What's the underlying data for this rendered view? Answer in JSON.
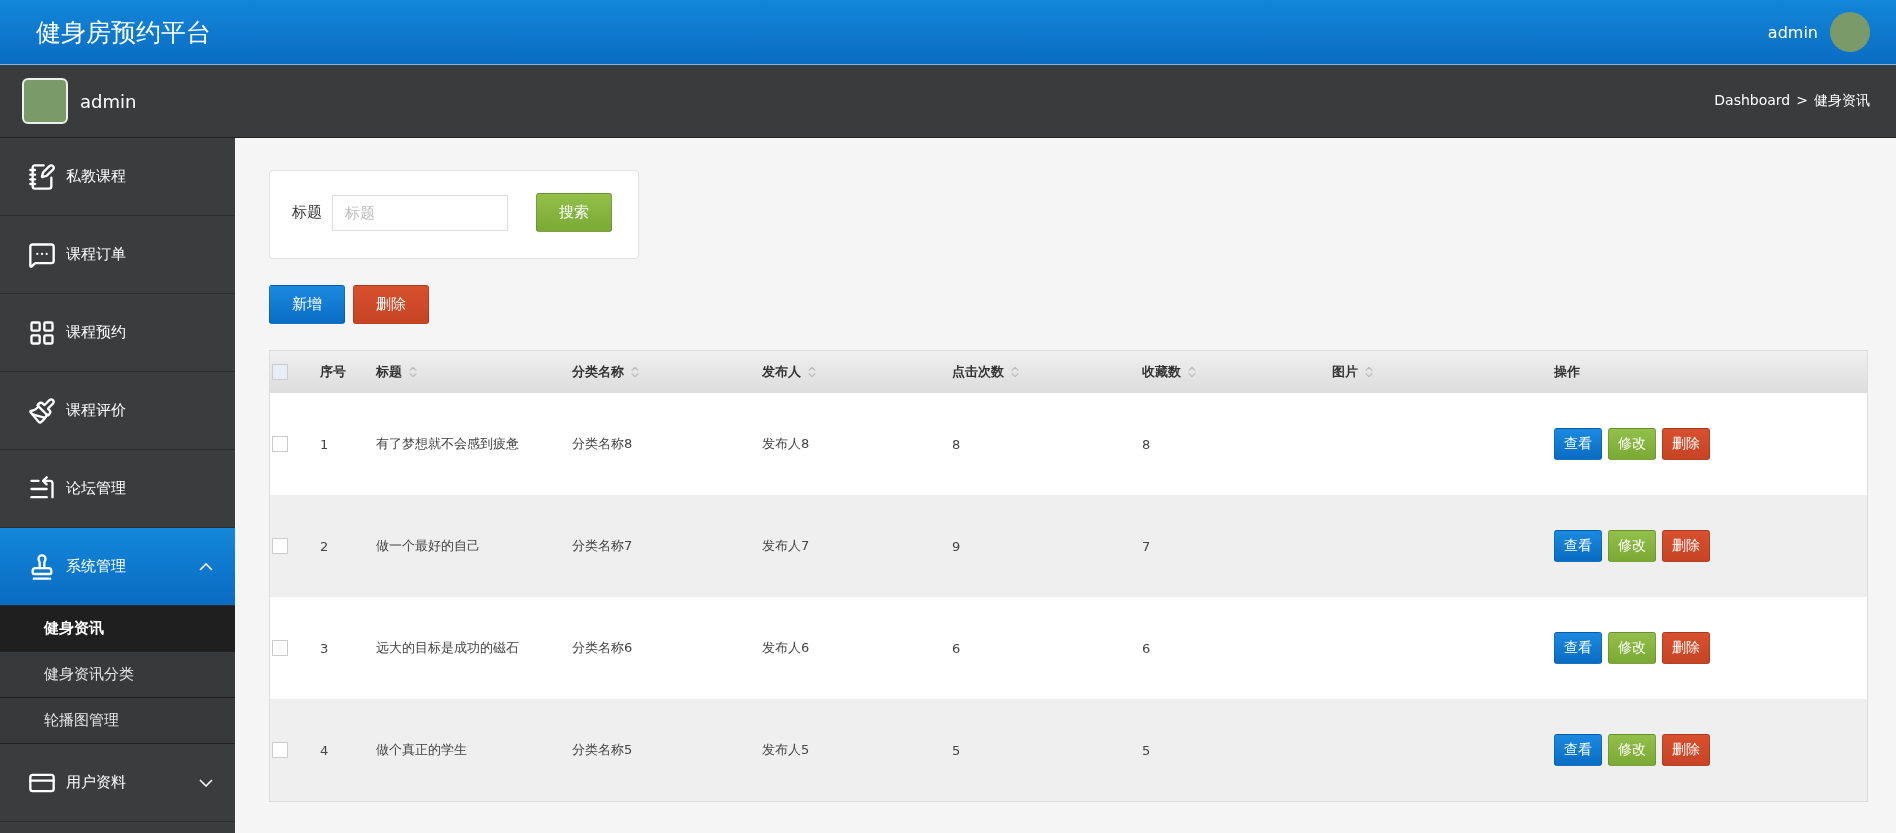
{
  "header": {
    "title": "健身房预约平台",
    "user": "admin"
  },
  "subheader": {
    "user": "admin",
    "breadcrumb": {
      "root": "Dashboard",
      "separator": ">",
      "current": "健身资讯"
    }
  },
  "sidebar": {
    "items": [
      {
        "label": "私教课程",
        "selected": false
      },
      {
        "label": "课程订单",
        "selected": false
      },
      {
        "label": "课程预约",
        "selected": false
      },
      {
        "label": "课程评价",
        "selected": false
      },
      {
        "label": "论坛管理",
        "selected": false
      },
      {
        "label": "系统管理",
        "selected": true,
        "expanded": true,
        "children": [
          {
            "label": "健身资讯",
            "selected": true
          },
          {
            "label": "健身资讯分类",
            "selected": false
          },
          {
            "label": "轮播图管理",
            "selected": false
          }
        ]
      },
      {
        "label": "用户资料",
        "selected": false,
        "expanded": false
      }
    ]
  },
  "search": {
    "label": "标题",
    "placeholder": "标题",
    "button": "搜索"
  },
  "actions": [
    {
      "label": "新增",
      "kind": "primary"
    },
    {
      "label": "删除",
      "kind": "danger"
    }
  ],
  "table": {
    "select_all": false,
    "columns": [
      {
        "label": "序号",
        "sortable": false
      },
      {
        "label": "标题",
        "sortable": true
      },
      {
        "label": "分类名称",
        "sortable": true
      },
      {
        "label": "发布人",
        "sortable": true
      },
      {
        "label": "点击次数",
        "sortable": true
      },
      {
        "label": "收藏数",
        "sortable": true
      },
      {
        "label": "图片",
        "sortable": true
      },
      {
        "label": "操作",
        "sortable": false
      }
    ],
    "rows": [
      {
        "checked": false,
        "index": "1",
        "title": "有了梦想就不会感到疲惫",
        "category": "分类名称8",
        "author": "发布人8",
        "clicks": "8",
        "favorites": "8",
        "actions": [
          {
            "label": "查看",
            "kind": "primary"
          },
          {
            "label": "修改",
            "kind": "success"
          },
          {
            "label": "删除",
            "kind": "danger"
          }
        ]
      },
      {
        "checked": false,
        "index": "2",
        "title": "做一个最好的自己",
        "category": "分类名称7",
        "author": "发布人7",
        "clicks": "9",
        "favorites": "7",
        "actions": [
          {
            "label": "查看",
            "kind": "primary"
          },
          {
            "label": "修改",
            "kind": "success"
          },
          {
            "label": "删除",
            "kind": "danger"
          }
        ]
      },
      {
        "checked": false,
        "index": "3",
        "title": "远大的目标是成功的磁石",
        "category": "分类名称6",
        "author": "发布人6",
        "clicks": "6",
        "favorites": "6",
        "actions": [
          {
            "label": "查看",
            "kind": "primary"
          },
          {
            "label": "修改",
            "kind": "success"
          },
          {
            "label": "删除",
            "kind": "danger"
          }
        ]
      },
      {
        "checked": false,
        "index": "4",
        "title": "做个真正的学生",
        "category": "分类名称5",
        "author": "发布人5",
        "clicks": "5",
        "favorites": "5",
        "actions": [
          {
            "label": "查看",
            "kind": "primary"
          },
          {
            "label": "修改",
            "kind": "success"
          },
          {
            "label": "删除",
            "kind": "danger"
          }
        ]
      }
    ]
  }
}
